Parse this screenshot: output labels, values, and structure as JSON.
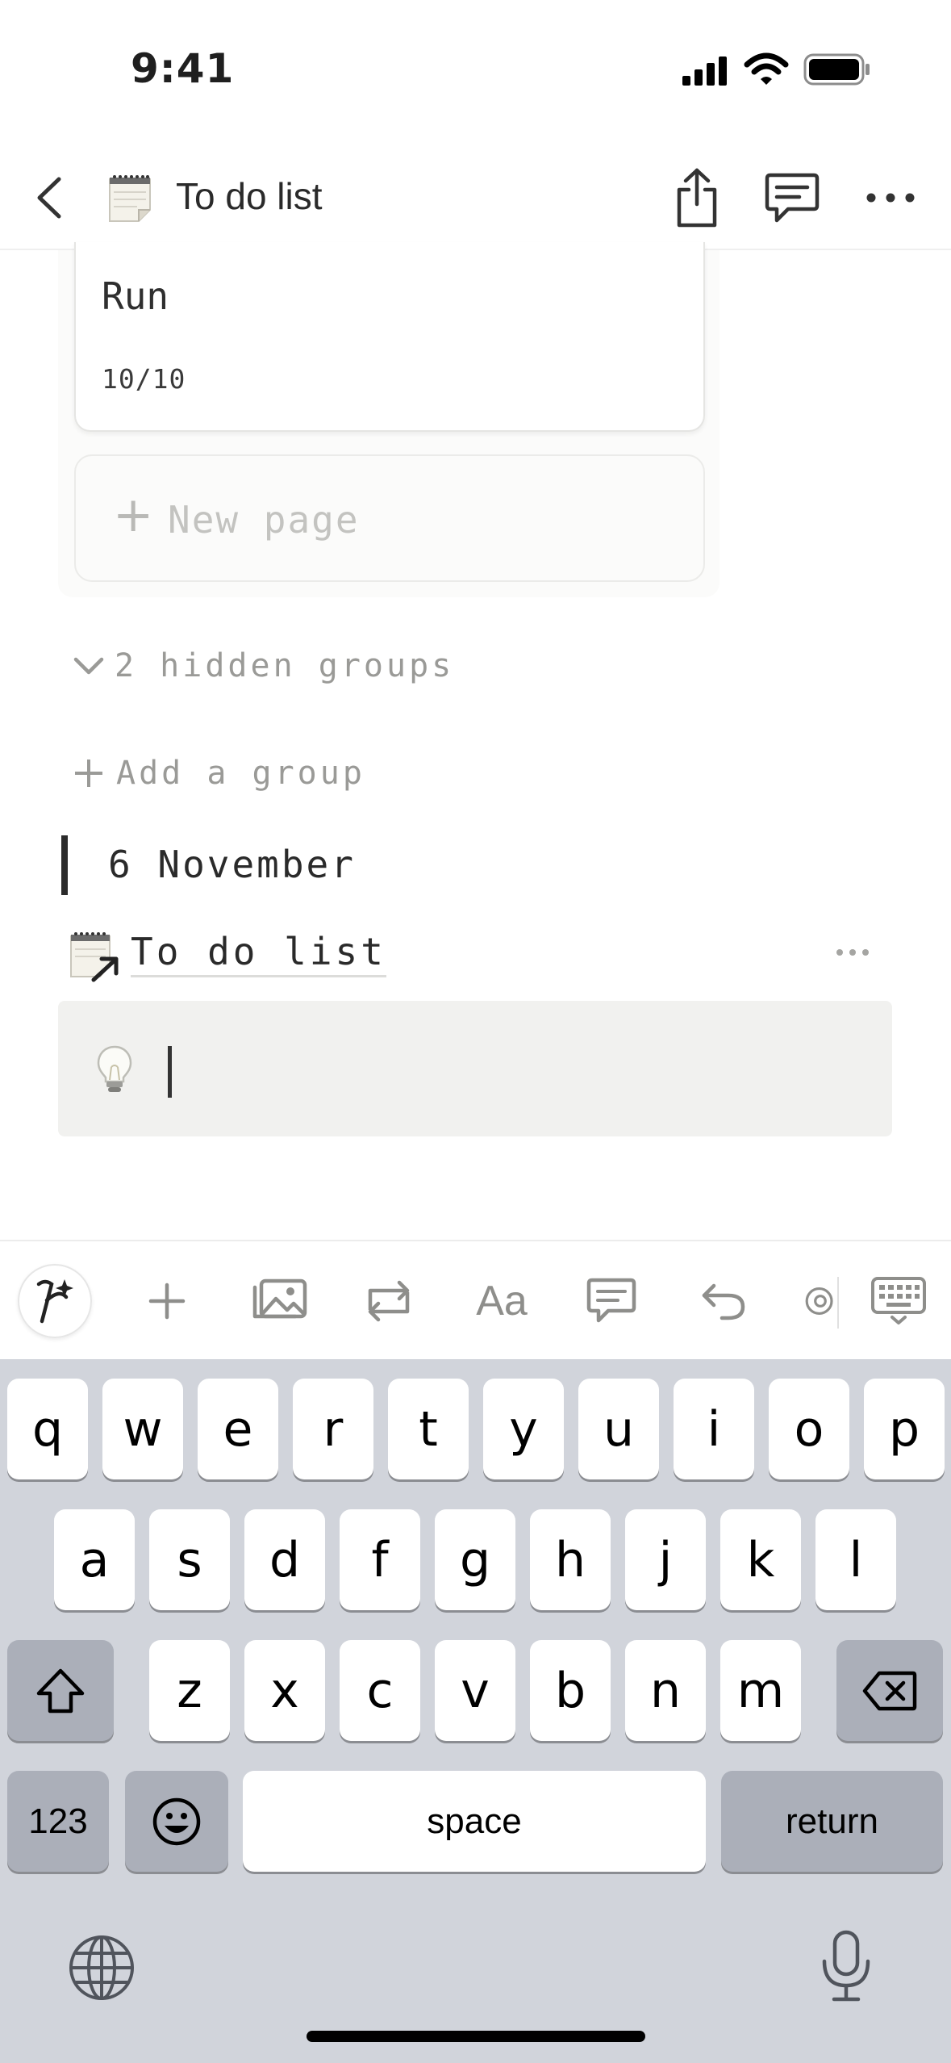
{
  "status": {
    "time": "9:41"
  },
  "nav": {
    "title": "To do list",
    "page_emoji": "notepad"
  },
  "board": {
    "card": {
      "title": "Run",
      "progress": "10/10"
    },
    "new_page_plus": "+",
    "new_page_label": "New page",
    "hidden_groups_label": "2 hidden groups",
    "add_group_plus": "+",
    "add_group_label": "Add a group"
  },
  "quote": {
    "text": "6 November"
  },
  "linked_page": {
    "title": "To do list"
  },
  "callout": {
    "icon": "lightbulb-icon",
    "text": ""
  },
  "toolbar": {
    "items": [
      "ai-icon",
      "plus-icon",
      "image-icon",
      "turn-into-icon",
      "text-format-icon",
      "comment-icon",
      "undo-icon",
      "mention-icon",
      "keyboard-hide-icon"
    ],
    "aa_label": "Aa"
  },
  "keyboard": {
    "row1": [
      "q",
      "w",
      "e",
      "r",
      "t",
      "y",
      "u",
      "i",
      "o",
      "p"
    ],
    "row2": [
      "a",
      "s",
      "d",
      "f",
      "g",
      "h",
      "j",
      "k",
      "l"
    ],
    "row3": [
      "z",
      "x",
      "c",
      "v",
      "b",
      "n",
      "m"
    ],
    "numbers_label": "123",
    "space_label": "space",
    "return_label": "return"
  }
}
